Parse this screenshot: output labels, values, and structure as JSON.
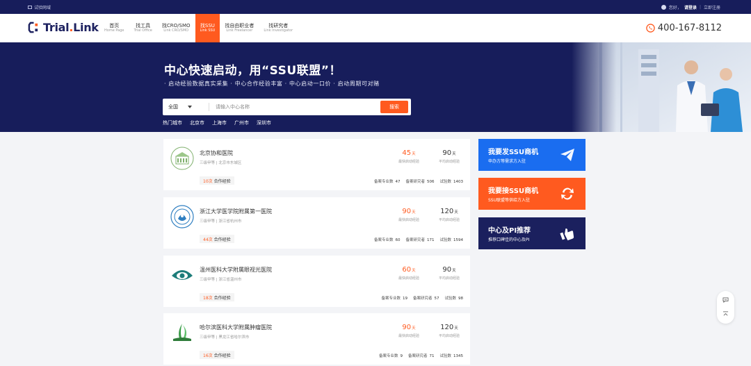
{
  "topbar": {
    "left_link": "试验网域",
    "greeting": "您好，",
    "login": "请登录",
    "register": "立即注册"
  },
  "brand": {
    "name_main": "Trial",
    "name_dot": ".",
    "name_tail": "Link"
  },
  "nav": {
    "items": [
      {
        "cn": "首页",
        "en": "Home Page"
      },
      {
        "cn": "找工具",
        "en": "Trial Office"
      },
      {
        "cn": "找CRO/SMO",
        "en": "Link CRO/SMO"
      },
      {
        "cn": "找SSU",
        "en": "Link SSU"
      },
      {
        "cn": "找自由职业者",
        "en": "Link Freelancer"
      },
      {
        "cn": "找研究者",
        "en": "Link Investigator"
      }
    ],
    "active_index": 3,
    "phone": "400-167-8112"
  },
  "hero": {
    "title": "中心快速启动，用“SSU联盟”！",
    "subtitle": "· 启动经验数据真实采集 · 中心合作经验丰富 · 中心启动一口价 · 启动周期可对赌",
    "search": {
      "region": "全国",
      "placeholder": "请输入中心名称",
      "button": "搜索"
    },
    "cities_label": "热门城市",
    "cities": [
      "北京市",
      "上海市",
      "广州市",
      "深圳市"
    ]
  },
  "list": {
    "fastest_label": "最快启动经验",
    "avg_label": "平均启动经验",
    "day_unit": "天",
    "coop_suffix": "合作经验",
    "count_labels": {
      "major": "备案专业数",
      "researcher": "备案研究者",
      "trials": "试验数"
    },
    "hospitals": [
      {
        "name": "北京协和医院",
        "meta": "三级甲等 | 北京市东城区",
        "fastest": "45",
        "avg": "90",
        "coop": "10次",
        "major": "47",
        "researcher": "506",
        "trials": "1403"
      },
      {
        "name": "浙江大学医学院附属第一医院",
        "meta": "三级甲等 | 浙江省杭州市",
        "fastest": "90",
        "avg": "120",
        "coop": "44次",
        "major": "60",
        "researcher": "171",
        "trials": "1594"
      },
      {
        "name": "温州医科大学附属眼视光医院",
        "meta": "三级甲等 | 浙江省温州市",
        "fastest": "60",
        "avg": "90",
        "coop": "18次",
        "major": "19",
        "researcher": "57",
        "trials": "98"
      },
      {
        "name": "哈尔滨医科大学附属肿瘤医院",
        "meta": "三级甲等 | 黑龙江省哈尔滨市",
        "fastest": "90",
        "avg": "120",
        "coop": "16次",
        "major": "9",
        "researcher": "71",
        "trials": "1345"
      }
    ]
  },
  "side": {
    "panels": [
      {
        "title": "我要发SSU商机",
        "desc": "申办方等需求方入驻"
      },
      {
        "title": "我要接SSU商机",
        "desc": "SSU联盟等供给方入驻"
      },
      {
        "title": "中心及PI推荐",
        "desc": "推荐口碑佳的中心及PI"
      }
    ]
  },
  "colors": {
    "navy": "#171d5b",
    "accent": "#ff5a1f",
    "blue": "#1a6df0"
  },
  "icons": [
    "user-icon",
    "phone-icon",
    "chevron-down-icon",
    "paper-plane-icon",
    "refresh-icon",
    "thumbs-up-icon",
    "message-icon",
    "back-to-top-icon"
  ]
}
